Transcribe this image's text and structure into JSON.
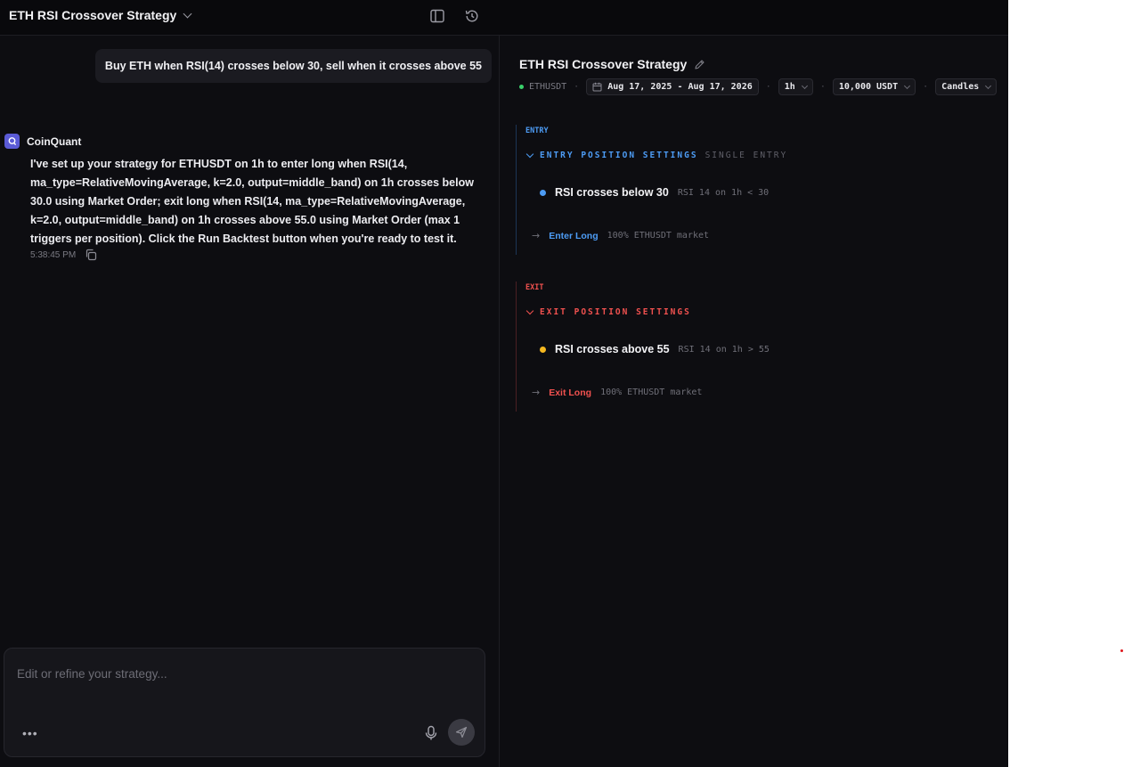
{
  "header": {
    "title": "ETH RSI Crossover Strategy"
  },
  "chat": {
    "user_message": "Buy ETH when RSI(14) crosses below 30, sell when it crosses above 55",
    "bot_name": "CoinQuant",
    "bot_message": "I've set up your strategy for ETHUSDT on 1h to enter long when RSI(14,\nma_type=RelativeMovingAverage, k=2.0, output=middle_band) on 1h crosses below\n30.0 using Market Order; exit long when RSI(14, ma_type=RelativeMovingAverage,\nk=2.0, output=middle_band) on 1h crosses above 55.0 using Market Order (max 1\ntriggers per position). Click the Run Backtest button when you're ready to test it.",
    "timestamp": "5:38:45 PM"
  },
  "composer": {
    "placeholder": "Edit or refine your strategy...",
    "more_label": "•••"
  },
  "strategy": {
    "title": "ETH RSI Crossover Strategy",
    "symbol": "ETHUSDT",
    "date_range": "Aug 17, 2025 - Aug 17, 2026",
    "timeframe": "1h",
    "capital": "10,000 USDT",
    "chart_type": "Candles",
    "separator": "·"
  },
  "entry": {
    "label": "ENTRY",
    "heading": "ENTRY POSITION SETTINGS",
    "subheading": "SINGLE ENTRY",
    "condition_title": "RSI crosses below 30",
    "condition_detail": "RSI 14 on 1h < 30",
    "action_label": "Enter Long",
    "action_detail": "100% ETHUSDT market"
  },
  "exit": {
    "label": "EXIT",
    "heading": "EXIT POSITION SETTINGS",
    "condition_title": "RSI crosses above 55",
    "condition_detail": "RSI 14 on 1h > 55",
    "action_label": "Exit Long",
    "action_detail": "100% ETHUSDT market"
  },
  "colors": {
    "accent_blue": "#4d9cf5",
    "exit_red": "#f0514f",
    "exit_dot": "#f5b820",
    "status_green": "#3ad16b",
    "brand_purple": "#5b5bd6"
  }
}
